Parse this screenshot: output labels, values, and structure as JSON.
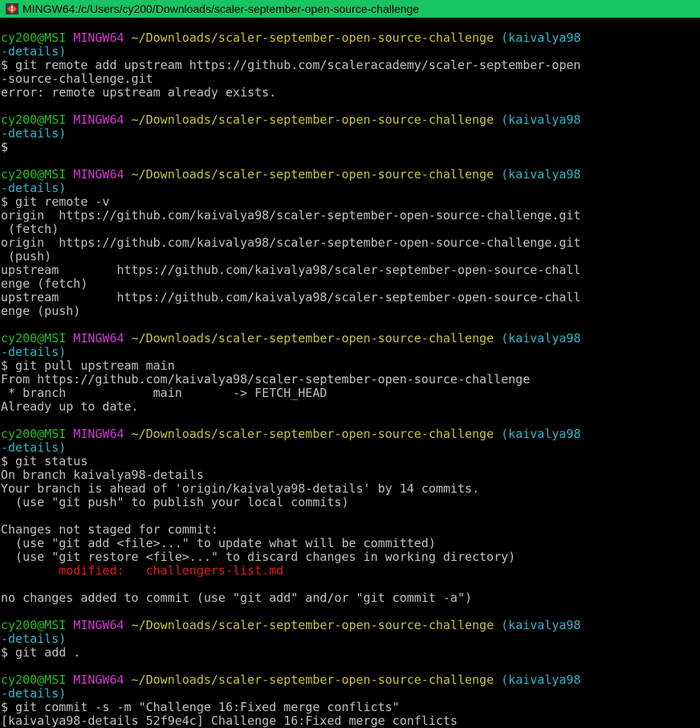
{
  "window": {
    "title": "MINGW64:/c/Users/cy200/Downloads/scaler-september-open-source-challenge",
    "icon": "git-bash-icon"
  },
  "colors": {
    "titlebar": "#19c463",
    "user_host": "#25bc24",
    "mingw": "#d338d3",
    "path": "#c7c43a",
    "branch": "#2fb5c9",
    "modified": "#e01e1e",
    "text": "#c0c0c0"
  },
  "terminal": {
    "lines": [
      [],
      [
        {
          "t": "cy200@MSI ",
          "c": "green"
        },
        {
          "t": "MINGW64 ",
          "c": "magenta"
        },
        {
          "t": "~/Downloads/scaler-september-open-source-challenge ",
          "c": "yellow"
        },
        {
          "t": "(kaivalya98",
          "c": "cyan"
        }
      ],
      [
        {
          "t": "-details)",
          "c": "cyan"
        }
      ],
      [
        {
          "t": "$ git remote add upstream https://github.com/scaleracademy/scaler-september-open",
          "c": "default"
        }
      ],
      [
        {
          "t": "-source-challenge.git",
          "c": "default"
        }
      ],
      [
        {
          "t": "error: remote upstream already exists.",
          "c": "default"
        }
      ],
      [],
      [
        {
          "t": "cy200@MSI ",
          "c": "green"
        },
        {
          "t": "MINGW64 ",
          "c": "magenta"
        },
        {
          "t": "~/Downloads/scaler-september-open-source-challenge ",
          "c": "yellow"
        },
        {
          "t": "(kaivalya98",
          "c": "cyan"
        }
      ],
      [
        {
          "t": "-details)",
          "c": "cyan"
        }
      ],
      [
        {
          "t": "$",
          "c": "default"
        }
      ],
      [],
      [
        {
          "t": "cy200@MSI ",
          "c": "green"
        },
        {
          "t": "MINGW64 ",
          "c": "magenta"
        },
        {
          "t": "~/Downloads/scaler-september-open-source-challenge ",
          "c": "yellow"
        },
        {
          "t": "(kaivalya98",
          "c": "cyan"
        }
      ],
      [
        {
          "t": "-details)",
          "c": "cyan"
        }
      ],
      [
        {
          "t": "$ git remote -v",
          "c": "default"
        }
      ],
      [
        {
          "t": "origin  https://github.com/kaivalya98/scaler-september-open-source-challenge.git",
          "c": "default"
        }
      ],
      [
        {
          "t": " (fetch)",
          "c": "default"
        }
      ],
      [
        {
          "t": "origin  https://github.com/kaivalya98/scaler-september-open-source-challenge.git",
          "c": "default"
        }
      ],
      [
        {
          "t": " (push)",
          "c": "default"
        }
      ],
      [
        {
          "t": "upstream        https://github.com/kaivalya98/scaler-september-open-source-chall",
          "c": "default"
        }
      ],
      [
        {
          "t": "enge (fetch)",
          "c": "default"
        }
      ],
      [
        {
          "t": "upstream        https://github.com/kaivalya98/scaler-september-open-source-chall",
          "c": "default"
        }
      ],
      [
        {
          "t": "enge (push)",
          "c": "default"
        }
      ],
      [],
      [
        {
          "t": "cy200@MSI ",
          "c": "green"
        },
        {
          "t": "MINGW64 ",
          "c": "magenta"
        },
        {
          "t": "~/Downloads/scaler-september-open-source-challenge ",
          "c": "yellow"
        },
        {
          "t": "(kaivalya98",
          "c": "cyan"
        }
      ],
      [
        {
          "t": "-details)",
          "c": "cyan"
        }
      ],
      [
        {
          "t": "$ git pull upstream main",
          "c": "default"
        }
      ],
      [
        {
          "t": "From https://github.com/kaivalya98/scaler-september-open-source-challenge",
          "c": "default"
        }
      ],
      [
        {
          "t": " * branch            main       -> FETCH_HEAD",
          "c": "default"
        }
      ],
      [
        {
          "t": "Already up to date.",
          "c": "default"
        }
      ],
      [],
      [
        {
          "t": "cy200@MSI ",
          "c": "green"
        },
        {
          "t": "MINGW64 ",
          "c": "magenta"
        },
        {
          "t": "~/Downloads/scaler-september-open-source-challenge ",
          "c": "yellow"
        },
        {
          "t": "(kaivalya98",
          "c": "cyan"
        }
      ],
      [
        {
          "t": "-details)",
          "c": "cyan"
        }
      ],
      [
        {
          "t": "$ git status",
          "c": "default"
        }
      ],
      [
        {
          "t": "On branch kaivalya98-details",
          "c": "default"
        }
      ],
      [
        {
          "t": "Your branch is ahead of 'origin/kaivalya98-details' by 14 commits.",
          "c": "default"
        }
      ],
      [
        {
          "t": "  (use \"git push\" to publish your local commits)",
          "c": "default"
        }
      ],
      [],
      [
        {
          "t": "Changes not staged for commit:",
          "c": "default"
        }
      ],
      [
        {
          "t": "  (use \"git add <file>...\" to update what will be committed)",
          "c": "default"
        }
      ],
      [
        {
          "t": "  (use \"git restore <file>...\" to discard changes in working directory)",
          "c": "default"
        }
      ],
      [
        {
          "t": "        modified:   challengers-list.md",
          "c": "red"
        }
      ],
      [],
      [
        {
          "t": "no changes added to commit (use \"git add\" and/or \"git commit -a\")",
          "c": "default"
        }
      ],
      [],
      [
        {
          "t": "cy200@MSI ",
          "c": "green"
        },
        {
          "t": "MINGW64 ",
          "c": "magenta"
        },
        {
          "t": "~/Downloads/scaler-september-open-source-challenge ",
          "c": "yellow"
        },
        {
          "t": "(kaivalya98",
          "c": "cyan"
        }
      ],
      [
        {
          "t": "-details)",
          "c": "cyan"
        }
      ],
      [
        {
          "t": "$ git add .",
          "c": "default"
        }
      ],
      [],
      [
        {
          "t": "cy200@MSI ",
          "c": "green"
        },
        {
          "t": "MINGW64 ",
          "c": "magenta"
        },
        {
          "t": "~/Downloads/scaler-september-open-source-challenge ",
          "c": "yellow"
        },
        {
          "t": "(kaivalya98",
          "c": "cyan"
        }
      ],
      [
        {
          "t": "-details)",
          "c": "cyan"
        }
      ],
      [
        {
          "t": "$ git commit -s -m \"Challenge 16:Fixed merge conflicts\"",
          "c": "default"
        }
      ],
      [
        {
          "t": "[kaivalya98-details 52f9e4c] Challenge 16:Fixed merge conflicts",
          "c": "default"
        }
      ]
    ]
  }
}
